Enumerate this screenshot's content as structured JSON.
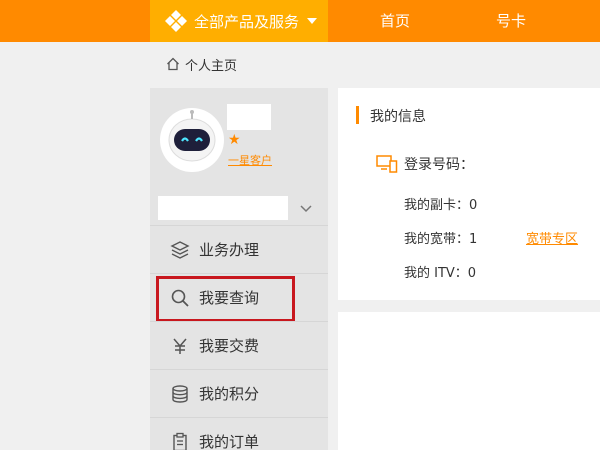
{
  "header": {
    "all_products_label": "全部产品及服务",
    "nav": {
      "home": "首页",
      "card": "号卡"
    }
  },
  "breadcrumb": {
    "label": "个人主页"
  },
  "profile": {
    "level_label": "一星客户",
    "star": "★"
  },
  "sidebar": {
    "items": [
      {
        "label": "业务办理",
        "icon": "layers-icon"
      },
      {
        "label": "我要查询",
        "icon": "search-icon"
      },
      {
        "label": "我要交费",
        "icon": "yuan-icon"
      },
      {
        "label": "我的积分",
        "icon": "database-icon"
      },
      {
        "label": "我的订单",
        "icon": "clipboard-icon"
      }
    ]
  },
  "info": {
    "title": "我的信息",
    "login_label": "登录号码：",
    "secondary_card": "我的副卡：0",
    "broadband": "我的宽带：1",
    "broadband_link": "宽带专区",
    "itv": "我的 ITV：0"
  },
  "colors": {
    "accent_orange": "#ff8a00",
    "highlight_red": "#c8171e"
  }
}
